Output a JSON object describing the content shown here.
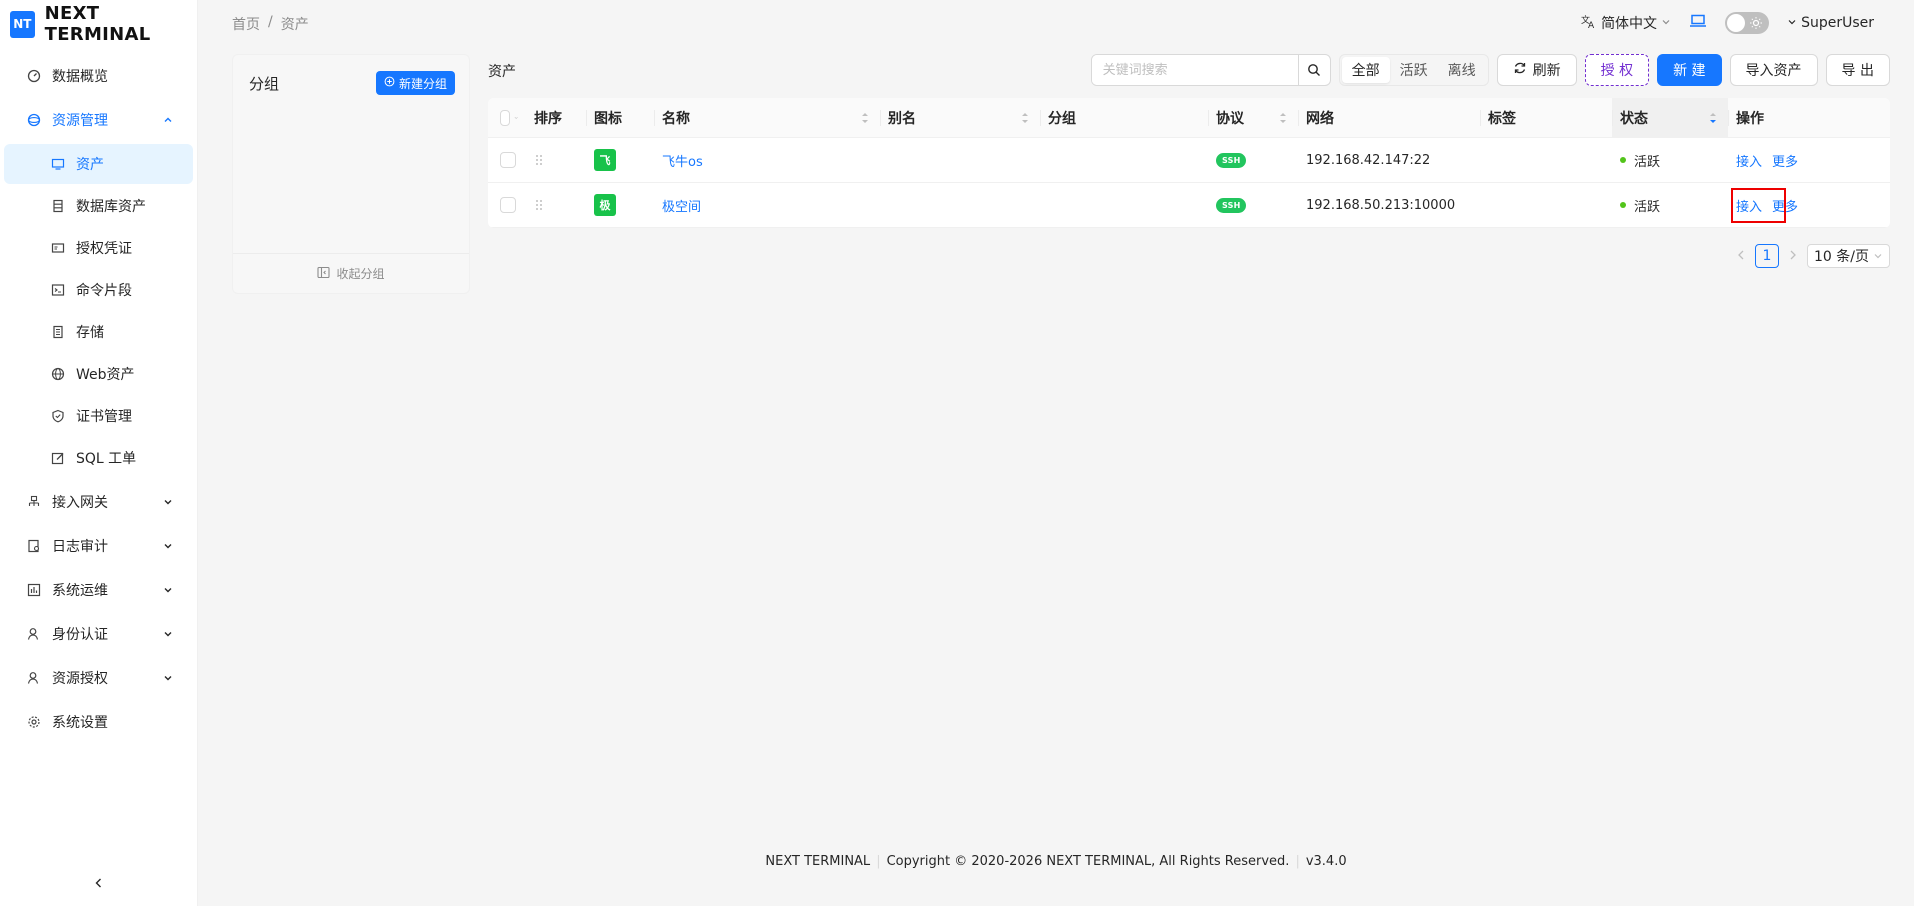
{
  "app": {
    "logo_badge": "NT",
    "logo_text": "NEXT TERMINAL"
  },
  "sidebar": {
    "items": [
      {
        "label": "数据概览",
        "icon": "dashboard-icon"
      },
      {
        "label": "资源管理",
        "icon": "cloud-icon",
        "expanded": true
      },
      {
        "label": "接入网关",
        "icon": "gateway-icon"
      },
      {
        "label": "日志审计",
        "icon": "log-icon"
      },
      {
        "label": "系统运维",
        "icon": "ops-icon"
      },
      {
        "label": "身份认证",
        "icon": "user-icon"
      },
      {
        "label": "资源授权",
        "icon": "user-icon"
      },
      {
        "label": "系统设置",
        "icon": "gear-icon"
      }
    ],
    "sub_items": [
      {
        "label": "资产",
        "icon": "monitor-icon",
        "active": true
      },
      {
        "label": "数据库资产",
        "icon": "database-icon"
      },
      {
        "label": "授权凭证",
        "icon": "credential-icon"
      },
      {
        "label": "命令片段",
        "icon": "terminal-icon"
      },
      {
        "label": "存储",
        "icon": "storage-icon"
      },
      {
        "label": "Web资产",
        "icon": "globe-icon"
      },
      {
        "label": "证书管理",
        "icon": "shield-icon"
      },
      {
        "label": "SQL 工单",
        "icon": "edit-icon"
      }
    ]
  },
  "header": {
    "breadcrumb_home": "首页",
    "breadcrumb_sep": "/",
    "breadcrumb_current": "资产",
    "language": "简体中文",
    "user": "SuperUser"
  },
  "group_panel": {
    "title": "分组",
    "new_group_label": "新建分组",
    "collapse_label": "收起分组"
  },
  "toolbar": {
    "title": "资产",
    "search_placeholder": "关键词搜索",
    "filters": [
      "全部",
      "活跃",
      "离线"
    ],
    "active_filter": "全部",
    "refresh_label": "刷新",
    "authorize_label": "授 权",
    "new_label": "新 建",
    "import_label": "导入资产",
    "export_label": "导 出"
  },
  "table": {
    "columns": {
      "sort": "排序",
      "icon": "图标",
      "name": "名称",
      "alias": "别名",
      "group": "分组",
      "protocol": "协议",
      "network": "网络",
      "tags": "标签",
      "status": "状态",
      "actions": "操作"
    },
    "rows": [
      {
        "icon_char": "飞",
        "name": "飞牛os",
        "alias": "",
        "group": "",
        "protocol": "SSH",
        "network": "192.168.42.147:22",
        "tags": "",
        "status": "活跃",
        "action_connect": "接入",
        "action_more": "更多"
      },
      {
        "icon_char": "极",
        "name": "极空间",
        "alias": "",
        "group": "",
        "protocol": "SSH",
        "network": "192.168.50.213:10000",
        "tags": "",
        "status": "活跃",
        "action_connect": "接入",
        "action_more": "更多"
      }
    ]
  },
  "pagination": {
    "current_page": "1",
    "page_size": "10 条/页"
  },
  "footer": {
    "brand": "NEXT TERMINAL",
    "copyright": "Copyright © 2020-2026 NEXT TERMINAL, All Rights Reserved.",
    "version": "v3.4.0"
  },
  "colors": {
    "primary": "#1677ff",
    "success": "#52c41a",
    "asset_icon_bg": "#18c24a",
    "authorize_border": "#722ed1",
    "highlight": "#ee0000"
  }
}
